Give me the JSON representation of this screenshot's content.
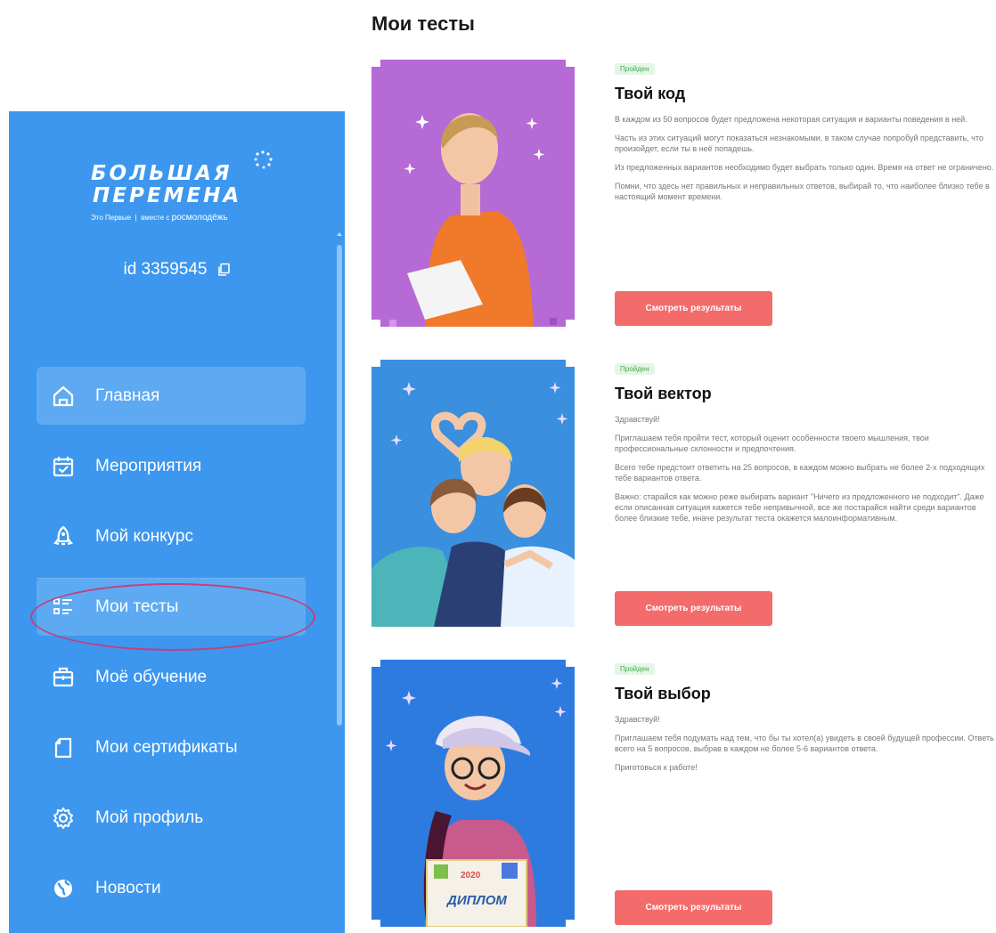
{
  "colors": {
    "sidebar_bg": "#3d97ee",
    "active_item": "#5eaaf2",
    "button": "#f46b6b",
    "badge_bg": "#e4f6e6",
    "badge_text": "#49a656",
    "card1_bg": "#b56ad6",
    "card2_bg": "#3a8fde",
    "card3_bg": "#2e7be0"
  },
  "sidebar": {
    "logo": {
      "line1": "БОЛЬШАЯ",
      "line2": "ПЕРЕМЕНА",
      "sub_left": "Это Первые",
      "sub_right": "вместе с",
      "sub_brand": "росмолодёжь"
    },
    "user_id": "id 3359545",
    "items": [
      {
        "label": "Главная",
        "icon": "home-icon",
        "active": true
      },
      {
        "label": "Мероприятия",
        "icon": "calendar-check-icon",
        "active": false
      },
      {
        "label": "Мой конкурс",
        "icon": "rocket-icon",
        "active": false
      },
      {
        "label": "Мои тесты",
        "icon": "list-icon",
        "active": true
      },
      {
        "label": "Моё обучение",
        "icon": "briefcase-icon",
        "active": false
      },
      {
        "label": "Мои сертификаты",
        "icon": "document-icon",
        "active": false
      },
      {
        "label": "Мой профиль",
        "icon": "gear-icon",
        "active": false
      },
      {
        "label": "Новости",
        "icon": "globe-icon",
        "active": false
      }
    ]
  },
  "main": {
    "title": "Мои тесты",
    "tests": [
      {
        "status": "Пройден",
        "title": "Твой код",
        "paragraphs": [
          "В каждом из 50 вопросов будет предложена некоторая ситуация и варианты поведения в ней.",
          "Часть из этих ситуаций могут показаться незнакомыми, в таком случае попробуй представить, что произойдет, если ты в неё попадешь.",
          "Из предложенных вариантов необходимо будет выбрать только один. Время на ответ не ограничено.",
          "Помни, что здесь нет правильных и неправильных ответов, выбирай то, что наиболее близко тебе в настоящий момент времени."
        ],
        "button": "Смотреть результаты"
      },
      {
        "status": "Пройден",
        "title": "Твой вектор",
        "paragraphs": [
          "Здравствуй!",
          "Приглашаем тебя пройти тест, который оценит особенности твоего мышления, твои профессиональные склонности и предпочтения.",
          "Всего тебе предстоит ответить на 25 вопросов, в каждом можно выбрать не более 2-х подходящих тебе вариантов ответа.",
          "Важно: старайся как можно реже выбирать вариант \"Ничего из предложенного не подходит\". Даже если описанная ситуация кажется тебе непривычной, все же постарайся найти среди вариантов более близкие тебе, иначе результат теста окажется малоинформативным."
        ],
        "button": "Смотреть результаты"
      },
      {
        "status": "Пройден",
        "title": "Твой выбор",
        "paragraphs": [
          "Здравствуй!",
          "Приглашаем тебя подумать над тем, что бы ты хотел(а) увидеть в своей будущей профессии. Ответь всего на 5 вопросов, выбрав в каждом не более 5-6 вариантов ответа.",
          "Приготовься к работе!"
        ],
        "button": "Смотреть результаты",
        "image_text": {
          "diploma": "ДИПЛОМ",
          "year": "2020"
        }
      }
    ]
  }
}
